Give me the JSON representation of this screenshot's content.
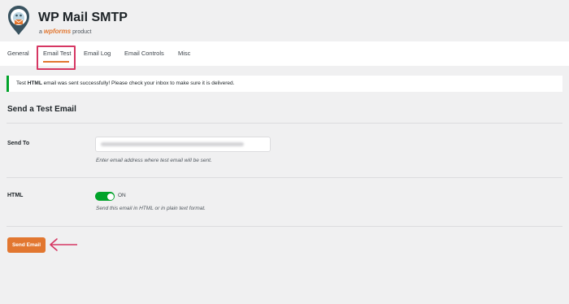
{
  "brand": {
    "title": "WP Mail SMTP",
    "sub_prefix": "a",
    "sub_brand": "wpforms",
    "sub_suffix": "product"
  },
  "tabs": [
    {
      "label": "General"
    },
    {
      "label": "Email Test",
      "active": true
    },
    {
      "label": "Email Log"
    },
    {
      "label": "Email Controls"
    },
    {
      "label": "Misc"
    }
  ],
  "notice": {
    "text_prefix": "Test ",
    "text_bold": "HTML",
    "text_suffix": " email was sent successfully! Please check your inbox to make sure it is delivered."
  },
  "section": {
    "title": "Send a Test Email"
  },
  "send_to": {
    "label": "Send To",
    "value": "",
    "help": "Enter email address where test email will be sent."
  },
  "html": {
    "label": "HTML",
    "toggle_state": "ON",
    "enabled": true,
    "help": "Send this email in HTML or in plain text format."
  },
  "actions": {
    "send_label": "Send Email"
  },
  "colors": {
    "accent": "#e27730",
    "success": "#00a32a",
    "highlight": "#d63763",
    "background": "#f0f0f1"
  },
  "icons": {
    "logo": "wp-mail-smtp-logo",
    "arrow": "left-arrow-annotation"
  }
}
